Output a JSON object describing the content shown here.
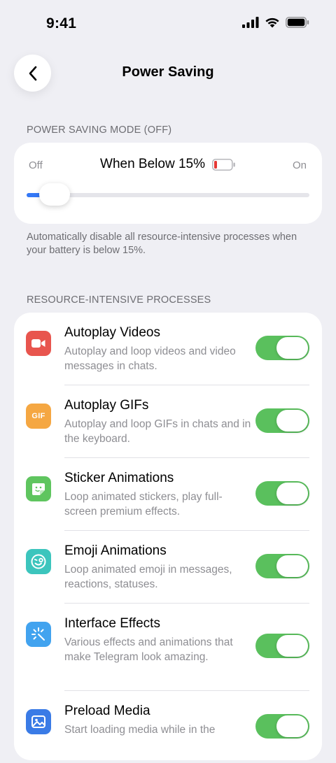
{
  "status_bar": {
    "time": "9:41"
  },
  "nav": {
    "title": "Power Saving"
  },
  "power_saving": {
    "header": "POWER SAVING MODE (OFF)",
    "off_label": "Off",
    "on_label": "On",
    "title": "When Below 15%",
    "slider_value_fraction": 0.1,
    "footer": "Automatically disable all resource-intensive processes when your battery is below 15%."
  },
  "processes": {
    "header": "RESOURCE-INTENSIVE PROCESSES",
    "items": [
      {
        "title": "Autoplay Videos",
        "subtitle": "Autoplay and loop videos and video messages in chats.",
        "icon": "video-camera-icon",
        "color": "#e8554e",
        "enabled": true
      },
      {
        "title": "Autoplay GIFs",
        "subtitle": "Autoplay and loop GIFs in chats and in the keyboard.",
        "icon": "gif-icon",
        "icon_text": "GIF",
        "color": "#f5a742",
        "enabled": true
      },
      {
        "title": "Sticker Animations",
        "subtitle": "Loop animated stickers, play full-screen premium effects.",
        "icon": "sticker-icon",
        "color": "#5fc55f",
        "enabled": true
      },
      {
        "title": "Emoji Animations",
        "subtitle": "Loop animated emoji in messages, reactions, statuses.",
        "icon": "emoji-icon",
        "color": "#3cc5bd",
        "enabled": true
      },
      {
        "title": "Interface Effects",
        "subtitle": "Various effects and animations that make Telegram look amazing.",
        "icon": "sparkle-icon",
        "color": "#42a3ef",
        "enabled": true
      },
      {
        "title": "Preload Media",
        "subtitle": "Start loading media while in the",
        "icon": "image-icon",
        "color": "#3a7be6",
        "enabled": true
      }
    ]
  }
}
